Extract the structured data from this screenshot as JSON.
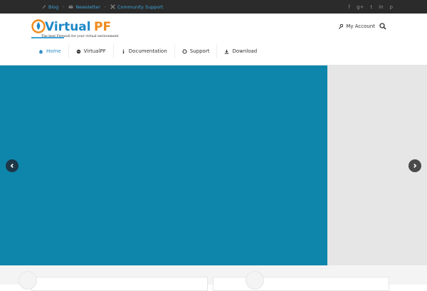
{
  "topbar": {
    "links": [
      {
        "label": "Blog",
        "icon": "feather-icon"
      },
      {
        "label": "Newsletter",
        "icon": "envelope-icon"
      },
      {
        "label": "Community Support",
        "icon": "tools-icon"
      }
    ],
    "separator": "-",
    "social": [
      {
        "icon": "facebook-icon",
        "glyph": "f"
      },
      {
        "icon": "google-plus-icon",
        "glyph": "g+"
      },
      {
        "icon": "twitter-icon",
        "glyph": "t"
      },
      {
        "icon": "linkedin-icon",
        "glyph": "in"
      },
      {
        "icon": "pinterest-icon",
        "glyph": "p"
      }
    ]
  },
  "header": {
    "logo_text_virtual": "Virtual",
    "logo_text_pf": "PF",
    "logo_tagline": "The best Firewall for your virtual environment",
    "my_account": "My Account"
  },
  "nav": {
    "items": [
      {
        "label": "Home",
        "icon": "home-icon"
      },
      {
        "label": "VirtualPF",
        "icon": "globe-icon"
      },
      {
        "label": "Documentation",
        "icon": "info-icon"
      },
      {
        "label": "Support",
        "icon": "lifebuoy-icon"
      },
      {
        "label": "Download",
        "icon": "download-icon"
      }
    ]
  },
  "colors": {
    "accent": "#3fa3d6",
    "slide_blue": "#0e86ab",
    "logo_blue": "#1e88c7",
    "logo_orange": "#f08a1c"
  }
}
